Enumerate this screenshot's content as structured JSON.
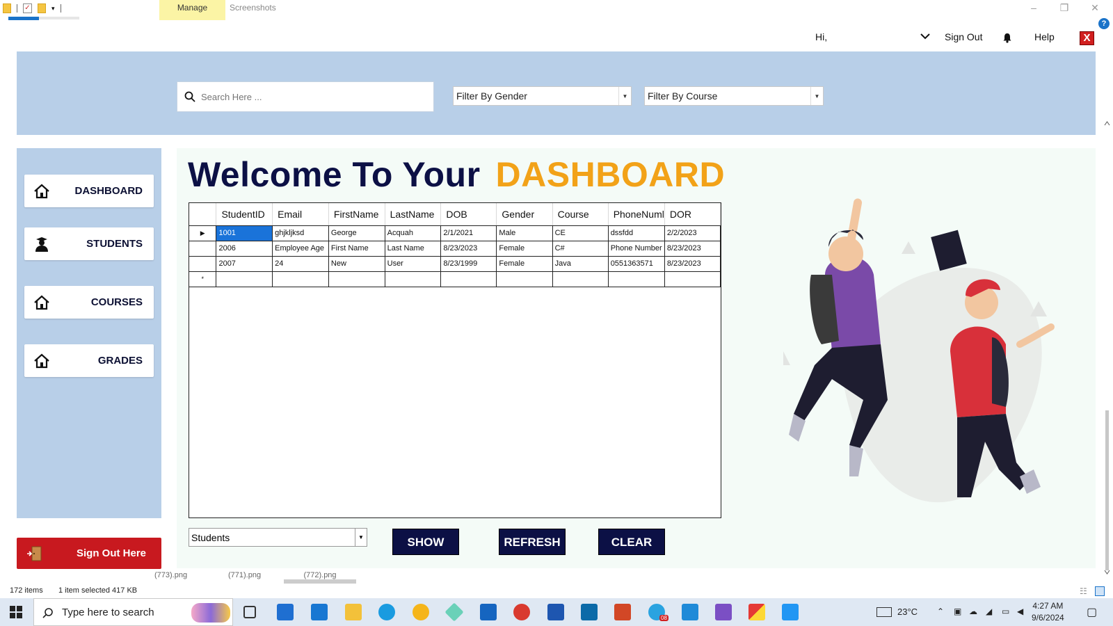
{
  "explorer": {
    "ribbon_tabs": [
      "Manage",
      "Screenshots"
    ],
    "status_items": "172 items",
    "status_selection": "1 item selected  417 KB",
    "thumb_labels": [
      "(773).png",
      "(771).png",
      "(772).png"
    ]
  },
  "header": {
    "greeting": "Hi,",
    "sign_out": "Sign Out",
    "help": "Help",
    "close_glyph": "X"
  },
  "filters": {
    "search_placeholder": "Search Here ...",
    "gender": "Filter By Gender",
    "course": "Filter By Course"
  },
  "sidebar": {
    "items": [
      {
        "label": "DASHBOARD",
        "icon": "home-icon"
      },
      {
        "label": "STUDENTS",
        "icon": "student-icon"
      },
      {
        "label": "COURSES",
        "icon": "home-icon"
      },
      {
        "label": "GRADES",
        "icon": "home-icon"
      }
    ],
    "sign_out": "Sign Out  Here"
  },
  "welcome": {
    "prefix": "Welcome To Your",
    "accent": "DASHBOARD"
  },
  "grid": {
    "columns": [
      "StudentID",
      "Email",
      "FirstName",
      "LastName",
      "DOB",
      "Gender",
      "Course",
      "PhoneNuml",
      "DOR"
    ],
    "rows": [
      [
        "1001",
        "ghjkljksd",
        "George",
        "Acquah",
        "2/1/2021",
        "Male",
        "CE",
        "dssfdd",
        "2/2/2023"
      ],
      [
        "2006",
        "Employee Age",
        "First Name",
        "Last Name",
        "8/23/2023",
        "Female",
        "C#",
        "Phone Number",
        "8/23/2023"
      ],
      [
        "2007",
        "24",
        "New",
        "User",
        "8/23/1999",
        "Female",
        "Java",
        "0551363571",
        "8/23/2023"
      ]
    ],
    "current_row_marker": "▶",
    "new_row_marker": "*"
  },
  "bottom": {
    "table_select": "Students",
    "buttons": [
      "SHOW",
      "REFRESH",
      "CLEAR"
    ]
  },
  "taskbar": {
    "search_text": "Type here to search",
    "weather": "23°C",
    "time": "4:27 AM",
    "date": "9/6/2024",
    "badge": "08"
  },
  "colors": {
    "band": "#b8cfe8",
    "navy": "#0c1045",
    "accent": "#f2a218",
    "danger": "#c8191f",
    "selection": "#1a73d9"
  }
}
